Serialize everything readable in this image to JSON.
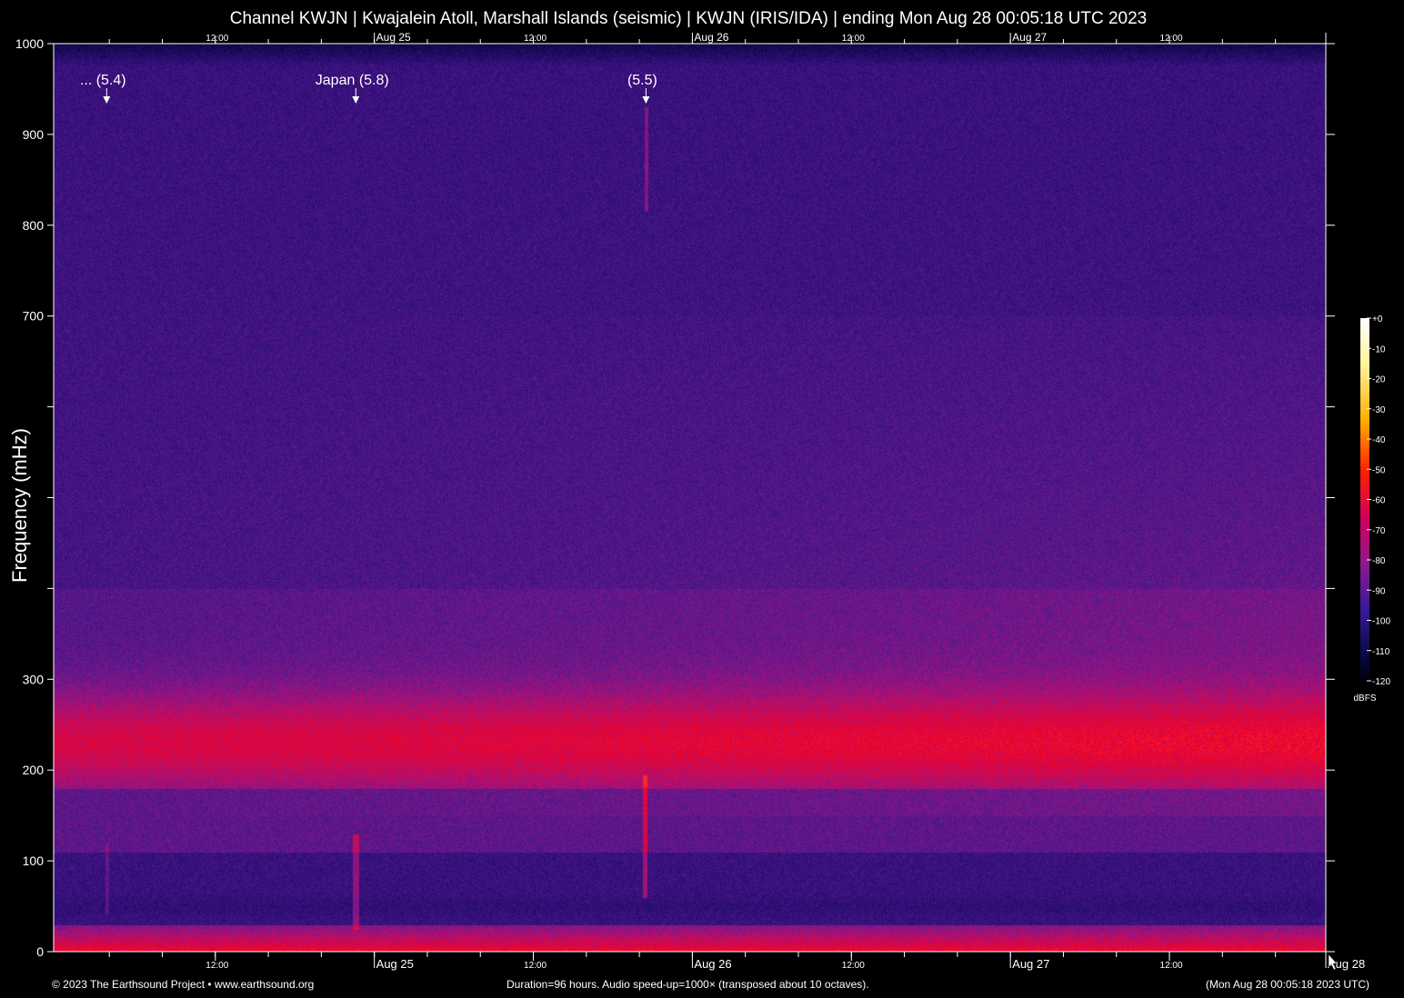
{
  "title": "Channel KWJN | Kwajalein Atoll, Marshall Islands (seismic) | KWJN (IRIS/IDA) | ending Mon Aug 28 00:05:18 UTC 2023",
  "footer": {
    "copyright": "© 2023 The Earthsound Project • www.earthsound.org",
    "duration": "Duration=96 hours. Audio speed-up=1000× (transposed about 10 octaves).",
    "timestamp": "(Mon Aug 28 00:05:18 2023 UTC)"
  },
  "colors": {
    "background": "#000000",
    "axis": "#ffffff",
    "spectrogram_low": "#2a0a6e",
    "spectrogram_mid": "#8a1a8a",
    "spectrogram_high": "#e8002a"
  },
  "chart_data": {
    "type": "heatmap",
    "title": "Channel KWJN | Kwajalein Atoll, Marshall Islands (seismic) | KWJN (IRIS/IDA) | ending Mon Aug 28 00:05:18 UTC 2023",
    "ylabel": "Frequency (mHz)",
    "xlabel": "",
    "ylim": [
      0,
      1000
    ],
    "xlim_hours": [
      0,
      96
    ],
    "y_ticks": [
      {
        "value": 0,
        "label": "0"
      },
      {
        "value": 100,
        "label": "100"
      },
      {
        "value": 200,
        "label": "200"
      },
      {
        "value": 300,
        "label": "300"
      },
      {
        "value": 400,
        "label": ""
      },
      {
        "value": 500,
        "label": ""
      },
      {
        "value": 600,
        "label": ""
      },
      {
        "value": 700,
        "label": "700"
      },
      {
        "value": 800,
        "label": "800"
      },
      {
        "value": 900,
        "label": "900"
      },
      {
        "value": 1000,
        "label": "1000"
      }
    ],
    "x_ticks_labeled": [
      {
        "hour": 12.2,
        "label": "12:00"
      },
      {
        "hour": 24.2,
        "label": "Aug 25"
      },
      {
        "hour": 36.2,
        "label": "12:00"
      },
      {
        "hour": 48.2,
        "label": "Aug 26"
      },
      {
        "hour": 60.2,
        "label": "12:00"
      },
      {
        "hour": 72.2,
        "label": "Aug 27"
      },
      {
        "hour": 84.2,
        "label": "12:00"
      },
      {
        "hour": 96.0,
        "label": "Aug 28"
      }
    ],
    "x_minor_tick_interval_hours": 4,
    "events": [
      {
        "hour": 4.0,
        "label": "... (5.4)"
      },
      {
        "hour": 22.8,
        "label": "Japan (5.8)"
      },
      {
        "hour": 44.7,
        "label": "(5.5)"
      }
    ],
    "colorbar": {
      "unit": "dBFS",
      "range": [
        -120,
        0
      ],
      "ticks": [
        "+0",
        "-10",
        "-20",
        "-30",
        "-40",
        "-50",
        "-60",
        "-70",
        "-80",
        "-90",
        "-100",
        "-110",
        "-120"
      ]
    },
    "grid": false,
    "legend": "right"
  }
}
